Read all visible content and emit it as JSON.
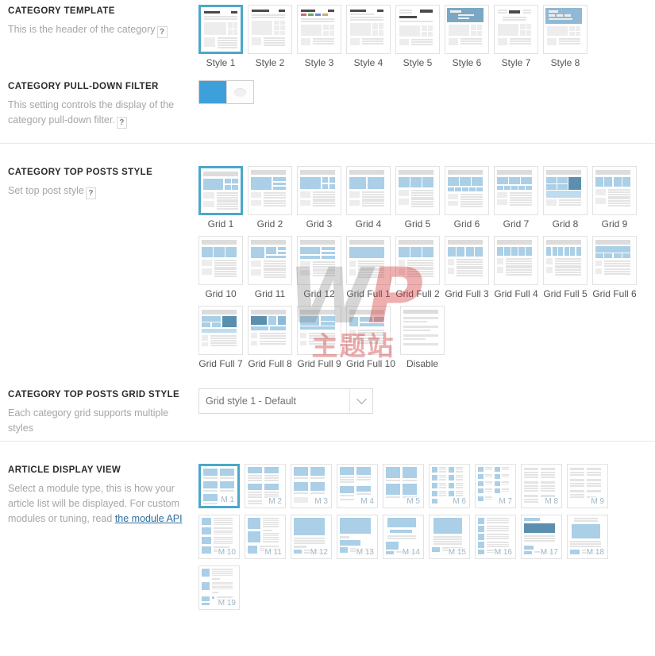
{
  "sections": [
    {
      "id": "category-template",
      "title": "CATEGORY TEMPLATE",
      "desc": "This is the header of the category",
      "help": "?",
      "options": [
        {
          "label": "Style 1",
          "selected": true
        },
        {
          "label": "Style 2",
          "selected": false
        },
        {
          "label": "Style 3",
          "selected": false
        },
        {
          "label": "Style 4",
          "selected": false
        },
        {
          "label": "Style 5",
          "selected": false
        },
        {
          "label": "Style 6",
          "selected": false
        },
        {
          "label": "Style 7",
          "selected": false
        },
        {
          "label": "Style 8",
          "selected": false
        }
      ]
    },
    {
      "id": "category-pull-down-filter",
      "title": "CATEGORY PULL-DOWN FILTER",
      "desc": "This setting controls the display of the category pull-down filter.",
      "help": "?",
      "toggle": {
        "state": "on",
        "label": "Category pull-down filter toggle"
      }
    },
    {
      "id": "category-top-posts-style",
      "title": "CATEGORY TOP POSTS STYLE",
      "desc": "Set top post style",
      "help": "?",
      "options": [
        {
          "label": "Grid 1",
          "selected": true
        },
        {
          "label": "Grid 2",
          "selected": false
        },
        {
          "label": "Grid 3",
          "selected": false
        },
        {
          "label": "Grid 4",
          "selected": false
        },
        {
          "label": "Grid 5",
          "selected": false
        },
        {
          "label": "Grid 6",
          "selected": false
        },
        {
          "label": "Grid 7",
          "selected": false
        },
        {
          "label": "Grid 8",
          "selected": false
        },
        {
          "label": "Grid 9",
          "selected": false
        },
        {
          "label": "Grid 10",
          "selected": false
        },
        {
          "label": "Grid 11",
          "selected": false
        },
        {
          "label": "Grid 12",
          "selected": false
        },
        {
          "label": "Grid Full 1",
          "selected": false
        },
        {
          "label": "Grid Full 2",
          "selected": false
        },
        {
          "label": "Grid Full 3",
          "selected": false
        },
        {
          "label": "Grid Full 4",
          "selected": false
        },
        {
          "label": "Grid Full 5",
          "selected": false
        },
        {
          "label": "Grid Full 6",
          "selected": false
        },
        {
          "label": "Grid Full 7",
          "selected": false
        },
        {
          "label": "Grid Full 8",
          "selected": false
        },
        {
          "label": "Grid Full 9",
          "selected": false
        },
        {
          "label": "Grid Full 10",
          "selected": false
        },
        {
          "label": "Disable",
          "selected": false
        }
      ]
    },
    {
      "id": "category-top-posts-grid-style",
      "title": "CATEGORY TOP POSTS GRID STYLE",
      "desc": "Each category grid supports multiple styles",
      "select": {
        "value": "Grid style 1 - Default",
        "icon": "chevron-down-icon"
      }
    },
    {
      "id": "article-display-view",
      "title": "ARTICLE DISPLAY VIEW",
      "desc_part1": "Select a module type, this is how your article list will be displayed. For custom modules or tuning, read ",
      "desc_link": "the module API",
      "options": [
        {
          "label": "M 1",
          "selected": true
        },
        {
          "label": "M 2",
          "selected": false
        },
        {
          "label": "M 3",
          "selected": false
        },
        {
          "label": "M 4",
          "selected": false
        },
        {
          "label": "M 5",
          "selected": false
        },
        {
          "label": "M 6",
          "selected": false
        },
        {
          "label": "M 7",
          "selected": false
        },
        {
          "label": "M 8",
          "selected": false
        },
        {
          "label": "M 9",
          "selected": false
        },
        {
          "label": "M 10",
          "selected": false
        },
        {
          "label": "M 11",
          "selected": false
        },
        {
          "label": "M 12",
          "selected": false
        },
        {
          "label": "M 13",
          "selected": false
        },
        {
          "label": "M 14",
          "selected": false
        },
        {
          "label": "M 15",
          "selected": false
        },
        {
          "label": "M 16",
          "selected": false
        },
        {
          "label": "M 17",
          "selected": false
        },
        {
          "label": "M 18",
          "selected": false
        },
        {
          "label": "M 19",
          "selected": false
        }
      ]
    }
  ],
  "watermark": {
    "text_w": "W",
    "text_p": "P",
    "text_cn": "主题站"
  },
  "colors": {
    "accent": "#4ba7c9",
    "toggle_on": "#3ea0db",
    "thumb_blue": "#aacfe6",
    "link": "#2f6f9f",
    "title": "#2b2b2b",
    "desc": "#a6a6a6",
    "divider": "#e8e8e8",
    "watermark_red": "#cf2d2d"
  }
}
